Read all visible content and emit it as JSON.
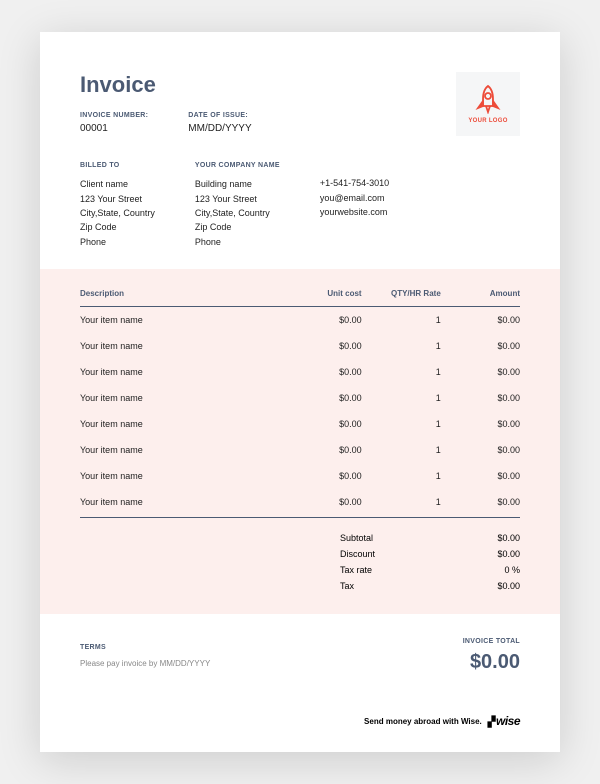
{
  "header": {
    "title": "Invoice",
    "invoice_number_label": "INVOICE NUMBER:",
    "invoice_number": "00001",
    "date_label": "DATE OF ISSUE:",
    "date_value": "MM/DD/YYYY",
    "logo_text": "YOUR LOGO"
  },
  "billed_to": {
    "label": "BILLED TO",
    "lines": [
      "Client name",
      "123 Your Street",
      "City,State, Country",
      "Zip Code",
      "Phone"
    ]
  },
  "company": {
    "label": "YOUR COMPANY NAME",
    "lines": [
      "Building name",
      "123 Your Street",
      "City,State, Country",
      "Zip Code",
      "Phone"
    ]
  },
  "contact": {
    "lines": [
      "+1-541-754-3010",
      "you@email.com",
      "yourwebsite.com"
    ]
  },
  "table": {
    "headers": {
      "desc": "Description",
      "unit": "Unit cost",
      "qty": "QTY/HR Rate",
      "amount": "Amount"
    },
    "rows": [
      {
        "desc": "Your item name",
        "unit": "$0.00",
        "qty": "1",
        "amount": "$0.00"
      },
      {
        "desc": "Your item name",
        "unit": "$0.00",
        "qty": "1",
        "amount": "$0.00"
      },
      {
        "desc": "Your item name",
        "unit": "$0.00",
        "qty": "1",
        "amount": "$0.00"
      },
      {
        "desc": "Your item name",
        "unit": "$0.00",
        "qty": "1",
        "amount": "$0.00"
      },
      {
        "desc": "Your item name",
        "unit": "$0.00",
        "qty": "1",
        "amount": "$0.00"
      },
      {
        "desc": "Your item name",
        "unit": "$0.00",
        "qty": "1",
        "amount": "$0.00"
      },
      {
        "desc": "Your item name",
        "unit": "$0.00",
        "qty": "1",
        "amount": "$0.00"
      },
      {
        "desc": "Your item name",
        "unit": "$0.00",
        "qty": "1",
        "amount": "$0.00"
      }
    ]
  },
  "totals": {
    "subtotal_label": "Subtotal",
    "subtotal": "$0.00",
    "discount_label": "Discount",
    "discount": "$0.00",
    "taxrate_label": "Tax rate",
    "taxrate": "0 %",
    "tax_label": "Tax",
    "tax": "$0.00"
  },
  "terms": {
    "label": "TERMS",
    "text": "Please pay invoice by MM/DD/YYYY"
  },
  "invoice_total": {
    "label": "INVOICE TOTAL",
    "amount": "$0.00"
  },
  "brand": {
    "tagline": "Send money abroad with Wise.",
    "name": "wise"
  }
}
